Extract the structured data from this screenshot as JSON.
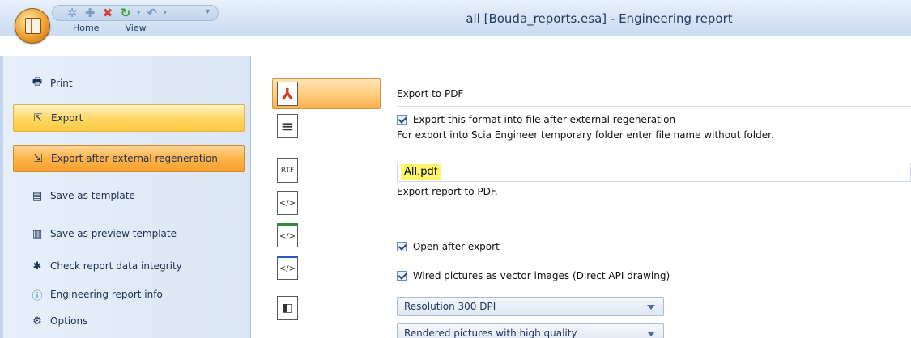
{
  "window": {
    "title": "all [Bouda_reports.esa] - Engineering report"
  },
  "ribbon": {
    "tabs": [
      {
        "label": "Home"
      },
      {
        "label": "View"
      }
    ]
  },
  "quick_access": {
    "icons": [
      "sun-icon",
      "plus-icon",
      "delete-icon",
      "refresh-icon",
      "undo-icon",
      "customize-icon"
    ]
  },
  "left_menu": {
    "items": [
      {
        "label": "Print",
        "icon": "printer-icon"
      },
      {
        "label": "Export",
        "icon": "export-icon",
        "state": "selected"
      },
      {
        "label": "Export after external regeneration",
        "icon": "export-regeneration-icon",
        "state": "active"
      },
      {
        "label": "Save as template",
        "icon": "template-icon"
      },
      {
        "label": "Save as preview template",
        "icon": "preview-template-icon"
      },
      {
        "label": "Check report data integrity",
        "icon": "integrity-icon"
      },
      {
        "label": "Engineering report info",
        "icon": "info-icon"
      },
      {
        "label": "Options",
        "icon": "gear-icon"
      }
    ]
  },
  "formats": [
    {
      "id": "pdf",
      "icon": "pdf-icon",
      "glyph": "⅄"
    },
    {
      "id": "txt",
      "icon": "text-document-icon",
      "glyph": "≡"
    },
    {
      "id": "rtf",
      "icon": "rtf-icon",
      "glyph": "RTF"
    },
    {
      "id": "html",
      "icon": "html-icon",
      "glyph": "</>"
    },
    {
      "id": "excel-html",
      "icon": "excel-html-icon",
      "glyph": "</>"
    },
    {
      "id": "word-html",
      "icon": "word-html-icon",
      "glyph": "</>"
    },
    {
      "id": "other",
      "icon": "document-icon",
      "glyph": "◧"
    }
  ],
  "settings": {
    "heading": "Export to PDF",
    "export_after_regen_label": "Export this format into file after external regeneration",
    "temp_folder_hint": "For export into Scia Engineer temporary folder enter file name without folder.",
    "file_name": "All.pdf",
    "export_description": "Export report to PDF.",
    "open_after_export_label": "Open after export",
    "wired_pictures_label": "Wired pictures as vector images (Direct API drawing)",
    "resolution_value": "Resolution 300 DPI",
    "rendered_quality_value": "Rendered pictures with high quality"
  }
}
